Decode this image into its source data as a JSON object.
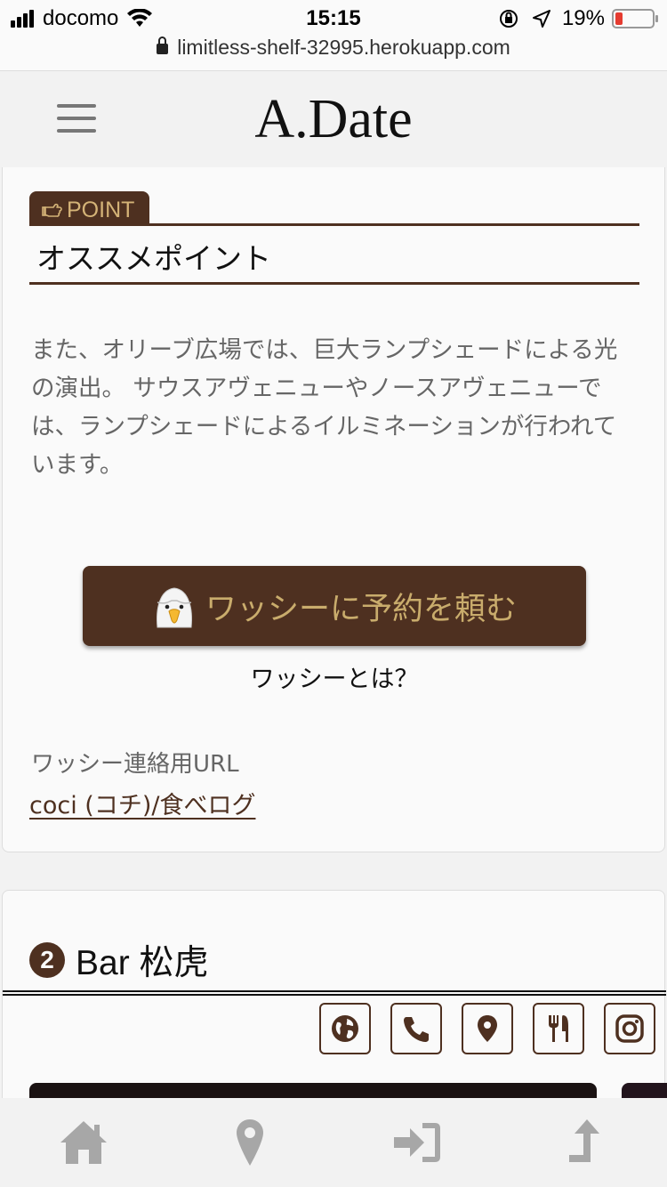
{
  "status_bar": {
    "carrier": "docomo",
    "time": "15:15",
    "battery": "19%"
  },
  "browser": {
    "url": "limitless-shelf-32995.herokuapp.com"
  },
  "header": {
    "logo": "A.Date"
  },
  "point_section": {
    "tag": "POINT",
    "title": "オススメポイント",
    "description": "また、オリーブ広場では、巨大ランプシェードによる光の演出。 サウスアヴェニューやノースアヴェニューでは、ランプシェードによるイルミネーションが行われています。"
  },
  "reservation": {
    "button_label": "ワッシーに予約を頼む",
    "what_label": "ワッシーとは？",
    "contact_label": "ワッシー連絡用URL",
    "contact_link": "coci (コチ)/食べログ"
  },
  "spot2": {
    "number": "2",
    "title": "Bar 松虎",
    "icons": [
      "globe-icon",
      "phone-icon",
      "map-pin-icon",
      "restaurant-icon",
      "instagram-icon"
    ]
  },
  "bottom_nav": {
    "items": [
      "home-icon",
      "map-pin-icon",
      "login-icon",
      "scroll-top-icon"
    ]
  },
  "colors": {
    "brand_brown": "#4e3020",
    "gold_text": "#c9ac6c",
    "battery_low": "#e53b30"
  }
}
